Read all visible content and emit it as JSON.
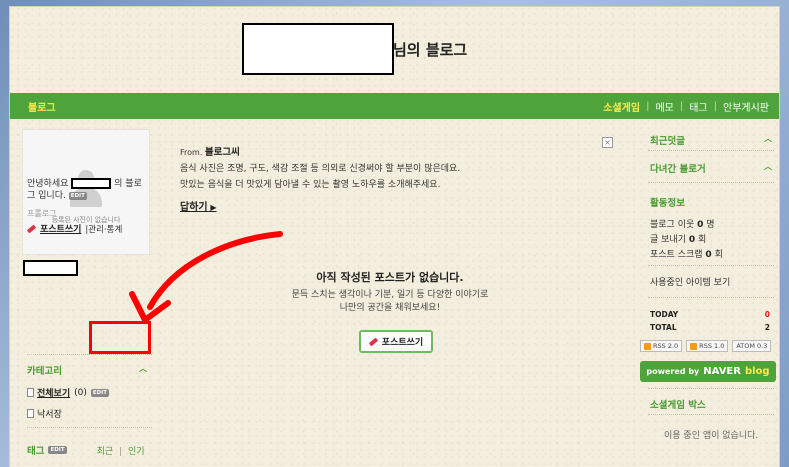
{
  "header": {
    "title_suffix": "님의 블로그"
  },
  "navbar": {
    "left_label": "블로그",
    "right_items": [
      "소셜게임",
      "메모",
      "태그",
      "안부게시판"
    ]
  },
  "profile": {
    "no_photo_text": "등록된 사진이 없습니다",
    "greeting_line1_prefix": "안녕하세요",
    "greeting_line1_suffix": "의 블로",
    "greeting_line2": "그 입니다.",
    "edit_label": "EDIT",
    "prologue": "프롤로그",
    "post_write": "포스트쓰기",
    "admin_stats": "관리·통계"
  },
  "category": {
    "title": "카테고리",
    "items": [
      {
        "label": "전체보기",
        "count": "(0)"
      },
      {
        "label": "낙서장",
        "count": ""
      }
    ]
  },
  "tags": {
    "title": "태그",
    "recent": "최근",
    "popular": "인기"
  },
  "notice": {
    "from_label": "From.",
    "from_name": "블로그씨",
    "line1": "음식 사진은 조명, 구도, 색감 조절 등 의외로 신경써야 할 부분이 많은데요.",
    "line2": "맛있는 음식을 더 맛있게 담아낼 수 있는 촬영 노하우를 소개해주세요.",
    "more": "답하기",
    "close": "×"
  },
  "empty": {
    "headline": "아직 작성된 포스트가 없습니다.",
    "sub1": "문득 스치는 생각이나 기분, 일기 등 다양한 이야기로",
    "sub2": "나만의 공간을 채워보세요!",
    "button": "포스트쓰기"
  },
  "sidebar": {
    "recent_comments": "최근덧글",
    "visited_blogs": "다녀간 블로거",
    "activity_title": "활동정보",
    "neighbors": {
      "label": "블로그 이웃",
      "value": "0",
      "unit": "명"
    },
    "sent_posts": {
      "label": "글 보내기",
      "value": "0",
      "unit": "회"
    },
    "scraps": {
      "label": "포스트 스크랩",
      "value": "0",
      "unit": "회"
    },
    "items_in_use": "사용중인 아이템 보기",
    "today_label": "TODAY",
    "today_value": "0",
    "total_label": "TOTAL",
    "total_value": "2",
    "feeds": [
      "RSS 2.0",
      "RSS 1.0",
      "ATOM 0.3"
    ],
    "powered_by": "powered by",
    "naver": "NAVER",
    "blog": "blog",
    "social_game_box": "소셜게임 박스",
    "no_apps": "이용 중인 앱이 없습니다."
  },
  "colors": {
    "nav_green": "#4ea43a",
    "accent_yellow": "#ffe94d",
    "annotation_red": "#ff0000"
  }
}
